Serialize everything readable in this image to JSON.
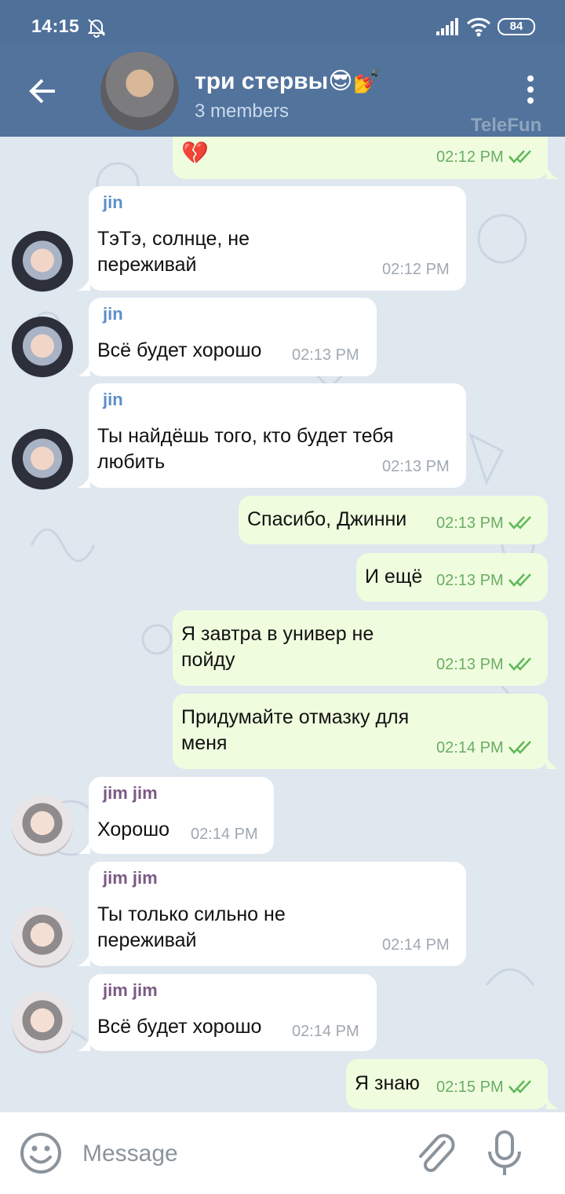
{
  "status": {
    "time": "14:15",
    "battery": "84"
  },
  "header": {
    "title": "три стервы😎💅",
    "subtitle": "3 members",
    "watermark": "TeleFun"
  },
  "messages": [
    {
      "dir": "out",
      "emoji": "💔",
      "time": "02:12 PM"
    },
    {
      "dir": "in",
      "sender": "jin",
      "lines": [
        "ТэТэ, солнце, не",
        "переживай"
      ],
      "time": "02:12 PM"
    },
    {
      "dir": "in",
      "sender": "jin",
      "lines": [
        "Всё будет хорошо"
      ],
      "time": "02:13 PM"
    },
    {
      "dir": "in",
      "sender": "jin",
      "lines": [
        "Ты найдёшь того, кто будет тебя",
        "любить"
      ],
      "time": "02:13 PM"
    },
    {
      "dir": "out",
      "lines": [
        "Спасибо, Джинни"
      ],
      "time": "02:13 PM"
    },
    {
      "dir": "out",
      "lines": [
        "И ещё"
      ],
      "time": "02:13 PM"
    },
    {
      "dir": "out",
      "lines": [
        "Я завтра в универ не",
        "пойду"
      ],
      "time": "02:13 PM"
    },
    {
      "dir": "out",
      "lines": [
        "Придумайте отмазку для",
        "меня"
      ],
      "time": "02:14 PM"
    },
    {
      "dir": "in",
      "sender": "jim jim",
      "lines": [
        "Хорошо"
      ],
      "time": "02:14 PM"
    },
    {
      "dir": "in",
      "sender": "jim jim",
      "lines": [
        "Ты только сильно не",
        "переживай"
      ],
      "time": "02:14 PM"
    },
    {
      "dir": "in",
      "sender": "jim jim",
      "lines": [
        "Всё будет хорошо"
      ],
      "time": "02:14 PM"
    },
    {
      "dir": "out",
      "lines": [
        "Я знаю"
      ],
      "time": "02:15 PM"
    }
  ],
  "input": {
    "placeholder": "Message"
  },
  "colors": {
    "header": "#52739c",
    "status_bar": "#4f7099",
    "outgoing_bubble": "#effdde",
    "incoming_bubble": "#ffffff",
    "read_ticks": "#5fb85a",
    "jin_name": "#5b8fc9",
    "jim_name": "#7a5a84"
  },
  "icons": [
    "back-arrow-icon",
    "more-vert-icon",
    "bell-off-icon",
    "signal-icon",
    "wifi-icon",
    "double-check-icon",
    "emoji-icon",
    "paperclip-icon",
    "microphone-icon"
  ]
}
